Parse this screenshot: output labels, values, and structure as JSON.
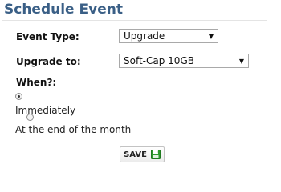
{
  "title": "Schedule Event",
  "event_type": {
    "label": "Event Type:",
    "selected": "Upgrade"
  },
  "upgrade_to": {
    "label": "Upgrade to:",
    "selected": "Soft-Cap 10GB"
  },
  "when": {
    "label": "When?:",
    "options": [
      {
        "label": "Immediately",
        "checked": true
      },
      {
        "label": "At the end of the month",
        "checked": false
      }
    ]
  },
  "save": {
    "label": "SAVE",
    "icon": "floppy-disk-icon",
    "icon_color": "#2e9a2e"
  }
}
